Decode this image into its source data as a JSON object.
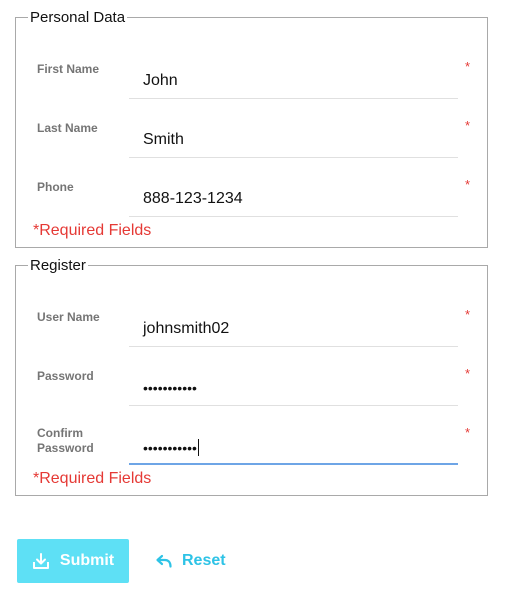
{
  "personal": {
    "legend": "Personal Data",
    "fields": [
      {
        "label": "First Name",
        "value": "John",
        "required": "*"
      },
      {
        "label": "Last Name",
        "value": "Smith",
        "required": "*"
      },
      {
        "label": "Phone",
        "value": "888-123-1234",
        "required": "*"
      }
    ],
    "note": "*Required Fields"
  },
  "register": {
    "legend": "Register",
    "fields": [
      {
        "label": "User Name",
        "value": "johnsmith02",
        "required": "*"
      },
      {
        "label": "Password",
        "value": "•••••••••••",
        "required": "*"
      },
      {
        "label_line1": "Confirm",
        "label_line2": "Password",
        "value": "•••••••••••",
        "required": "*"
      }
    ],
    "note": "*Required Fields"
  },
  "actions": {
    "submit_label": "Submit",
    "submit_icon": "download-icon",
    "reset_label": "Reset",
    "reset_icon": "undo-icon"
  },
  "colors": {
    "accent": "#5ee0f5",
    "reset_text": "#2ec3e6",
    "required": "#e53935",
    "focus_underline": "#6ea5e6"
  }
}
